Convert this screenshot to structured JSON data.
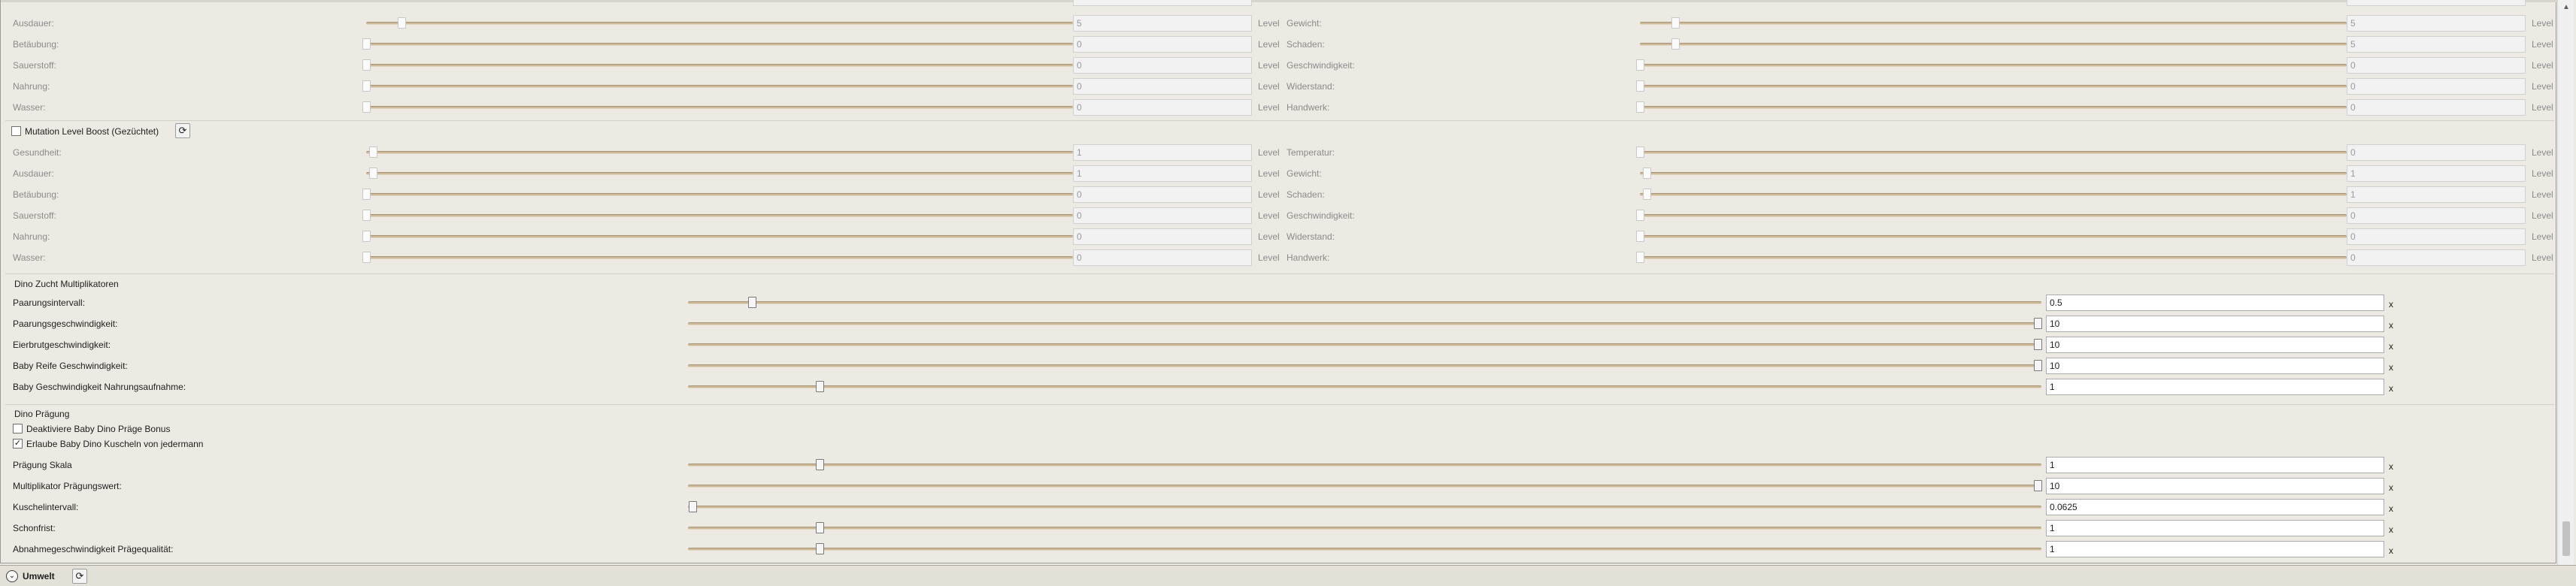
{
  "levels_a": {
    "rows": [
      {
        "left_label": "Ausdauer:",
        "left_value": "5",
        "left_pos": 0.05,
        "right_label": "Gewicht:",
        "right_value": "5",
        "right_pos": 0.05
      },
      {
        "left_label": "Betäubung:",
        "left_value": "0",
        "left_pos": 0.0,
        "right_label": "Schaden:",
        "right_value": "5",
        "right_pos": 0.05
      },
      {
        "left_label": "Sauerstoff:",
        "left_value": "0",
        "left_pos": 0.0,
        "right_label": "Geschwindigkeit:",
        "right_value": "0",
        "right_pos": 0.0
      },
      {
        "left_label": "Nahrung:",
        "left_value": "0",
        "left_pos": 0.0,
        "right_label": "Widerstand:",
        "right_value": "0",
        "right_pos": 0.0
      },
      {
        "left_label": "Wasser:",
        "left_value": "0",
        "left_pos": 0.0,
        "right_label": "Handwerk:",
        "right_value": "0",
        "right_pos": 0.0
      }
    ]
  },
  "mutation": {
    "checkbox_label": "Mutation Level Boost (Gezüchtet)",
    "checked": false,
    "refresh_icon": "refresh-icon",
    "rows": [
      {
        "left_label": "Gesundheit:",
        "left_value": "1",
        "left_pos": 0.01,
        "right_label": "Temperatur:",
        "right_value": "0",
        "right_pos": 0.0
      },
      {
        "left_label": "Ausdauer:",
        "left_value": "1",
        "left_pos": 0.01,
        "right_label": "Gewicht:",
        "right_value": "1",
        "right_pos": 0.01
      },
      {
        "left_label": "Betäubung:",
        "left_value": "0",
        "left_pos": 0.0,
        "right_label": "Schaden:",
        "right_value": "1",
        "right_pos": 0.01
      },
      {
        "left_label": "Sauerstoff:",
        "left_value": "0",
        "left_pos": 0.0,
        "right_label": "Geschwindigkeit:",
        "right_value": "0",
        "right_pos": 0.0
      },
      {
        "left_label": "Nahrung:",
        "left_value": "0",
        "left_pos": 0.0,
        "right_label": "Widerstand:",
        "right_value": "0",
        "right_pos": 0.0
      },
      {
        "left_label": "Wasser:",
        "left_value": "0",
        "left_pos": 0.0,
        "right_label": "Handwerk:",
        "right_value": "0",
        "right_pos": 0.0
      }
    ]
  },
  "unit_level": "Level",
  "unit_x": "x",
  "breeding": {
    "title": "Dino Zucht Multiplikatoren",
    "rows": [
      {
        "label": "Paarungsintervall:",
        "value": "0.5",
        "pos": 0.05
      },
      {
        "label": "Paarungsgeschwindigkeit:",
        "value": "10",
        "pos": 1.0
      },
      {
        "label": "Eierbrutgeschwindigkeit:",
        "value": "10",
        "pos": 1.0
      },
      {
        "label": "Baby Reife Geschwindigkeit:",
        "value": "10",
        "pos": 1.0
      },
      {
        "label": "Baby Geschwindigkeit Nahrungsaufnahme:",
        "value": "1",
        "pos": 0.1
      }
    ]
  },
  "imprint": {
    "title": "Dino Prägung",
    "checkbox1_label": "Deaktiviere Baby Dino Präge Bonus",
    "checkbox1_checked": false,
    "checkbox2_label": "Erlaube Baby Dino Kuscheln von jedermann",
    "checkbox2_checked": true,
    "check_mark": "✓",
    "rows": [
      {
        "label": "Prägung Skala",
        "value": "1",
        "pos": 0.1
      },
      {
        "label": "Multiplikator Prägungswert:",
        "value": "10",
        "pos": 1.0
      },
      {
        "label": "Kuschelintervall:",
        "value": "0.0625",
        "pos": 0.006
      },
      {
        "label": "Schonfrist:",
        "value": "1",
        "pos": 0.1
      },
      {
        "label": "Abnahmegeschwindigkeit Prägequalität:",
        "value": "1",
        "pos": 0.1
      }
    ]
  },
  "bottom": {
    "section_title": "Umwelt",
    "expand_icon": "chevron-down-icon",
    "refresh_icon": "refresh-icon"
  },
  "scrollbar": {
    "up_arrow": "▲",
    "down_arrow": "▼"
  }
}
